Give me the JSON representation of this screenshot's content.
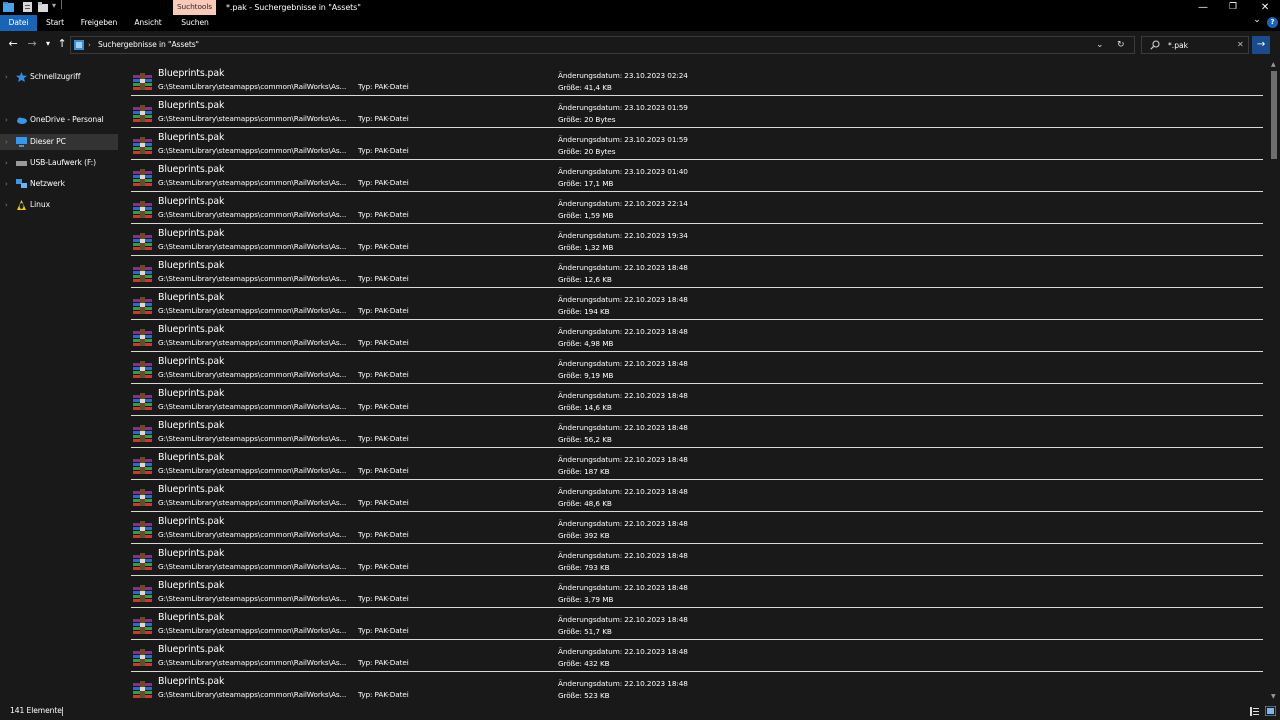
{
  "titlebar": {
    "contextual_tab": "Suchtools",
    "window_title": "*.pak - Suchergebnisse in \"Assets\"",
    "minimize": "—",
    "maximize": "❐",
    "close": "✕"
  },
  "ribbon": {
    "tabs": [
      "Datei",
      "Start",
      "Freigeben",
      "Ansicht",
      "Suchen"
    ],
    "expand": "⌄",
    "help": "?"
  },
  "addressbar": {
    "breadcrumb": "Suchergebnisse in \"Assets\"",
    "dropdown": "⌄",
    "refresh": "↻"
  },
  "search": {
    "value": "*.pak",
    "clear": "✕",
    "go": "→"
  },
  "navpane": {
    "items": [
      {
        "label": "Schnellzugriff",
        "icon": "star-icon"
      },
      {
        "label": "OneDrive - Personal",
        "icon": "cloud-icon"
      },
      {
        "label": "Dieser PC",
        "icon": "computer-icon"
      },
      {
        "label": "USB-Laufwerk (F:)",
        "icon": "usb-drive-icon"
      },
      {
        "label": "Netzwerk",
        "icon": "network-icon"
      },
      {
        "label": "Linux",
        "icon": "linux-icon"
      }
    ]
  },
  "results": {
    "type_label": "Typ: PAK-Datei",
    "rows": [
      {
        "name": "Blueprints.pak",
        "path": "G:\\SteamLibrary\\steamapps\\common\\RailWorks\\As...",
        "date": "Änderungsdatum: 23.10.2023 02:24",
        "size": "Größe: 41,4 KB"
      },
      {
        "name": "Blueprints.pak",
        "path": "G:\\SteamLibrary\\steamapps\\common\\RailWorks\\As...",
        "date": "Änderungsdatum: 23.10.2023 01:59",
        "size": "Größe: 20 Bytes"
      },
      {
        "name": "Blueprints.pak",
        "path": "G:\\SteamLibrary\\steamapps\\common\\RailWorks\\As...",
        "date": "Änderungsdatum: 23.10.2023 01:59",
        "size": "Größe: 20 Bytes"
      },
      {
        "name": "Blueprints.pak",
        "path": "G:\\SteamLibrary\\steamapps\\common\\RailWorks\\As...",
        "date": "Änderungsdatum: 23.10.2023 01:40",
        "size": "Größe: 17,1 MB"
      },
      {
        "name": "Blueprints.pak",
        "path": "G:\\SteamLibrary\\steamapps\\common\\RailWorks\\As...",
        "date": "Änderungsdatum: 22.10.2023 22:14",
        "size": "Größe: 1,59 MB"
      },
      {
        "name": "Blueprints.pak",
        "path": "G:\\SteamLibrary\\steamapps\\common\\RailWorks\\As...",
        "date": "Änderungsdatum: 22.10.2023 19:34",
        "size": "Größe: 1,32 MB"
      },
      {
        "name": "Blueprints.pak",
        "path": "G:\\SteamLibrary\\steamapps\\common\\RailWorks\\As...",
        "date": "Änderungsdatum: 22.10.2023 18:48",
        "size": "Größe: 12,6 KB"
      },
      {
        "name": "Blueprints.pak",
        "path": "G:\\SteamLibrary\\steamapps\\common\\RailWorks\\As...",
        "date": "Änderungsdatum: 22.10.2023 18:48",
        "size": "Größe: 194 KB"
      },
      {
        "name": "Blueprints.pak",
        "path": "G:\\SteamLibrary\\steamapps\\common\\RailWorks\\As...",
        "date": "Änderungsdatum: 22.10.2023 18:48",
        "size": "Größe: 4,98 MB"
      },
      {
        "name": "Blueprints.pak",
        "path": "G:\\SteamLibrary\\steamapps\\common\\RailWorks\\As...",
        "date": "Änderungsdatum: 22.10.2023 18:48",
        "size": "Größe: 9,19 MB"
      },
      {
        "name": "Blueprints.pak",
        "path": "G:\\SteamLibrary\\steamapps\\common\\RailWorks\\As...",
        "date": "Änderungsdatum: 22.10.2023 18:48",
        "size": "Größe: 14,6 KB"
      },
      {
        "name": "Blueprints.pak",
        "path": "G:\\SteamLibrary\\steamapps\\common\\RailWorks\\As...",
        "date": "Änderungsdatum: 22.10.2023 18:48",
        "size": "Größe: 56,2 KB"
      },
      {
        "name": "Blueprints.pak",
        "path": "G:\\SteamLibrary\\steamapps\\common\\RailWorks\\As...",
        "date": "Änderungsdatum: 22.10.2023 18:48",
        "size": "Größe: 187 KB"
      },
      {
        "name": "Blueprints.pak",
        "path": "G:\\SteamLibrary\\steamapps\\common\\RailWorks\\As...",
        "date": "Änderungsdatum: 22.10.2023 18:48",
        "size": "Größe: 48,6 KB"
      },
      {
        "name": "Blueprints.pak",
        "path": "G:\\SteamLibrary\\steamapps\\common\\RailWorks\\As...",
        "date": "Änderungsdatum: 22.10.2023 18:48",
        "size": "Größe: 392 KB"
      },
      {
        "name": "Blueprints.pak",
        "path": "G:\\SteamLibrary\\steamapps\\common\\RailWorks\\As...",
        "date": "Änderungsdatum: 22.10.2023 18:48",
        "size": "Größe: 793 KB"
      },
      {
        "name": "Blueprints.pak",
        "path": "G:\\SteamLibrary\\steamapps\\common\\RailWorks\\As...",
        "date": "Änderungsdatum: 22.10.2023 18:48",
        "size": "Größe: 3,79 MB"
      },
      {
        "name": "Blueprints.pak",
        "path": "G:\\SteamLibrary\\steamapps\\common\\RailWorks\\As...",
        "date": "Änderungsdatum: 22.10.2023 18:48",
        "size": "Größe: 51,7 KB"
      },
      {
        "name": "Blueprints.pak",
        "path": "G:\\SteamLibrary\\steamapps\\common\\RailWorks\\As...",
        "date": "Änderungsdatum: 22.10.2023 18:48",
        "size": "Größe: 432 KB"
      },
      {
        "name": "Blueprints.pak",
        "path": "G:\\SteamLibrary\\steamapps\\common\\RailWorks\\As...",
        "date": "Änderungsdatum: 22.10.2023 18:48",
        "size": "Größe: 523 KB"
      }
    ]
  },
  "statusbar": {
    "count": "141 Elemente"
  },
  "colors": {
    "background": "#191919",
    "ribbon_active": "#1a64b6",
    "contextual_tab": "#f9c9ba",
    "selected_nav": "#333333"
  }
}
